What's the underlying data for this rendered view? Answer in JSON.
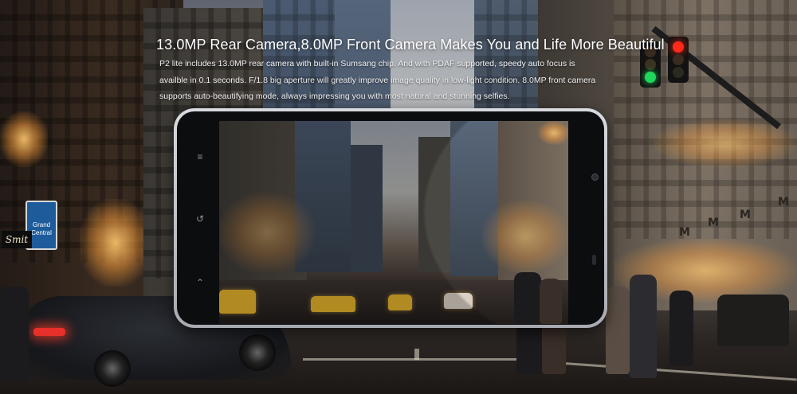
{
  "headline": "13.0MP Rear Camera,8.0MP Front Camera Makes You and Life More Beautiful",
  "body_lines": [
    "P2 lite includes 13.0MP rear camera with built-in Sumsang chip. And with PDAF supported, speedy auto focus is",
    "availble in 0.1 seconds. F/1.8 big aperture will greatly improve image quality in low-light condition. 8.0MP front camera",
    "supports auto-beautifying mode, always impressing you with most natural and stunning selfies."
  ],
  "street_signs": {
    "grand_central": "Grand Central",
    "smith": "Smit"
  },
  "store_banner_letters": [
    "M",
    "M",
    "M",
    "M"
  ],
  "colors": {
    "text": "#ffffff",
    "phone_frame": "#c4c7cc",
    "taxi": "#e3b22a",
    "traffic_red": "#ff2a1a",
    "traffic_green": "#1fd65a"
  },
  "icons": {
    "menu_key": "menu-icon",
    "back_key": "back-icon",
    "home_key": "home-icon"
  }
}
